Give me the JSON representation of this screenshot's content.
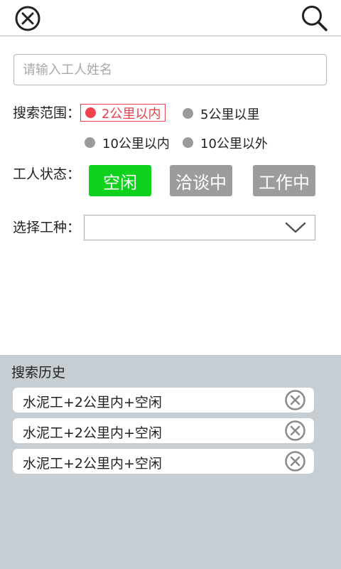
{
  "topbar": {
    "close_icon": "close-circle-icon",
    "search_icon": "search-icon"
  },
  "search": {
    "placeholder": "请输入工人姓名",
    "value": ""
  },
  "range": {
    "label": "搜索范围：",
    "options": [
      "2公里以内",
      "5公里以里",
      "10公里以内",
      "10公里以外"
    ],
    "selected": "2公里以内",
    "selected_color": "#f1424f",
    "unselected_color": "#9a9a9a"
  },
  "status": {
    "label": "工人状态：",
    "options": [
      "空闲",
      "洽谈中",
      "工作中"
    ],
    "selected": "空闲",
    "active_color": "#10d21e",
    "inactive_color": "#9c9c9c"
  },
  "worktype": {
    "label": "选择工种：",
    "value": "",
    "icon": "chevron-down-icon"
  },
  "history": {
    "title": "搜索历史",
    "background": "#c6ced4",
    "items": [
      "水泥工+2公里内+空闲",
      "水泥工+2公里内+空闲",
      "水泥工+2公里内+空闲"
    ],
    "delete_icon": "close-circle-icon"
  }
}
